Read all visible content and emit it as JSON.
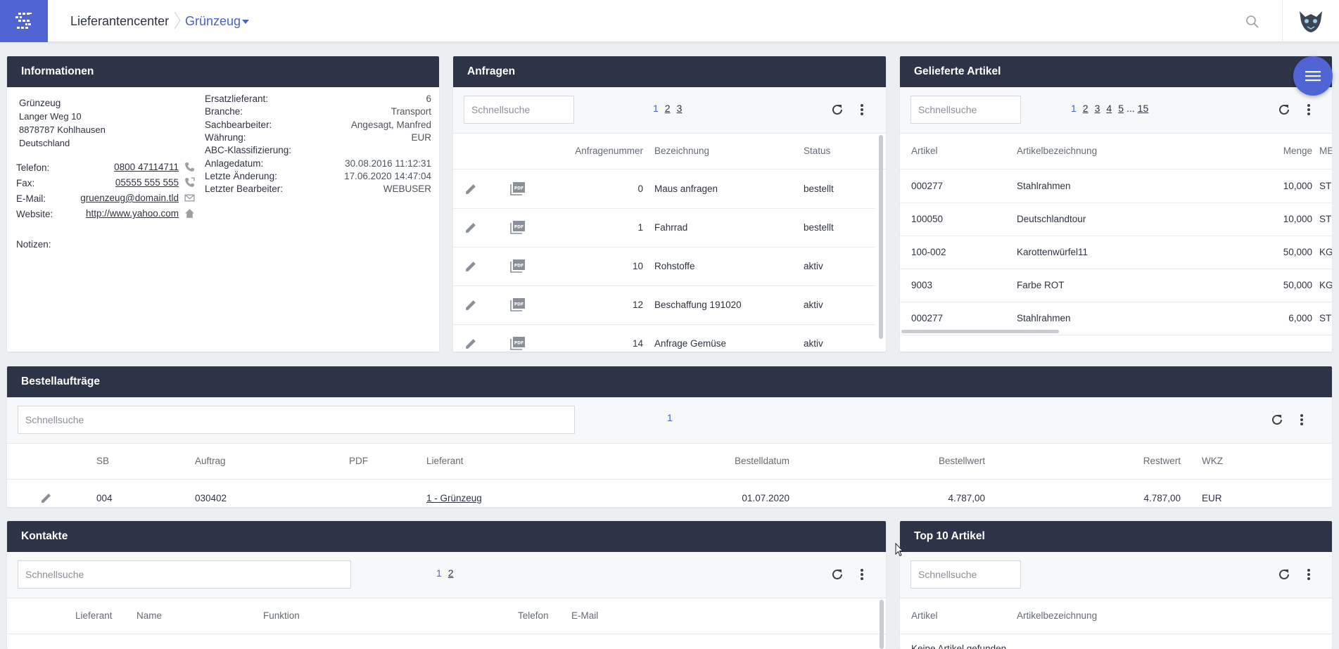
{
  "header": {
    "breadcrumb_root": "Lieferantencenter",
    "breadcrumb_current": "Grünzeug"
  },
  "colors": {
    "accent": "#5164d4",
    "panel_header": "#2e3447",
    "background": "#eceff2"
  },
  "info": {
    "title": "Informationen",
    "address": [
      "Grünzeug",
      "Langer Weg 10",
      "8878787 Kohlhausen",
      "Deutschland"
    ],
    "contacts": [
      {
        "label": "Telefon:",
        "value": "0800 47114711",
        "icon": "phone-icon"
      },
      {
        "label": "Fax:",
        "value": "05555 555 555",
        "icon": "fax-icon"
      },
      {
        "label": "E-Mail:",
        "value": "gruenzeug@domain.tld",
        "icon": "mail-icon"
      },
      {
        "label": "Website:",
        "value": "http://www.yahoo.com",
        "icon": "home-icon"
      }
    ],
    "notes_label": "Notizen:",
    "fields": [
      {
        "label": "Ersatzlieferant:",
        "value": "6"
      },
      {
        "label": "Branche:",
        "value": "Transport"
      },
      {
        "label": "Sachbearbeiter:",
        "value": "Angesagt, Manfred"
      },
      {
        "label": "Währung:",
        "value": "EUR"
      },
      {
        "label": "ABC-Klassifizierung:",
        "value": ""
      },
      {
        "label": "Anlagedatum:",
        "value": "30.08.2016 11:12:31"
      },
      {
        "label": "Letzte Änderung:",
        "value": "17.06.2020 14:47:04"
      },
      {
        "label": "Letzter Bearbeiter:",
        "value": "WEBUSER"
      }
    ]
  },
  "anfragen": {
    "title": "Anfragen",
    "search_placeholder": "Schnellsuche",
    "pages": [
      "1",
      "2",
      "3"
    ],
    "columns": [
      "Anfragenummer",
      "Bezeichnung",
      "Status"
    ],
    "rows": [
      {
        "nr": "0",
        "bez": "Maus anfragen",
        "status": "bestellt"
      },
      {
        "nr": "1",
        "bez": "Fahrrad",
        "status": "bestellt"
      },
      {
        "nr": "10",
        "bez": "Rohstoffe",
        "status": "aktiv"
      },
      {
        "nr": "12",
        "bez": "Beschaffung 191020",
        "status": "aktiv"
      },
      {
        "nr": "14",
        "bez": "Anfrage Gemüse",
        "status": "aktiv"
      }
    ]
  },
  "geliefert": {
    "title": "Gelieferte Artikel",
    "search_placeholder": "Schnellsuche",
    "pages": [
      "1",
      "2",
      "3",
      "4",
      "5"
    ],
    "ellipsis": "...",
    "last_page": "15",
    "columns": [
      "Artikel",
      "Artikelbezeichnung",
      "Menge",
      "ME"
    ],
    "rows": [
      {
        "art": "000277",
        "bez": "Stahlrahmen",
        "menge": "10,000",
        "me": "ST"
      },
      {
        "art": "100050",
        "bez": "Deutschlandtour",
        "menge": "10,000",
        "me": "ST"
      },
      {
        "art": "100-002",
        "bez": "Karottenwürfel11",
        "menge": "50,000",
        "me": "KG"
      },
      {
        "art": "9003",
        "bez": "Farbe ROT",
        "menge": "50,000",
        "me": "KG"
      },
      {
        "art": "000277",
        "bez": "Stahlrahmen",
        "menge": "6,000",
        "me": "ST"
      }
    ]
  },
  "bestell": {
    "title": "Bestellaufträge",
    "search_placeholder": "Schnellsuche",
    "pages": [
      "1"
    ],
    "columns": [
      "SB",
      "Auftrag",
      "PDF",
      "Lieferant",
      "Bestelldatum",
      "Bestellwert",
      "Restwert",
      "WKZ"
    ],
    "rows": [
      {
        "sb": "004",
        "auftrag": "030402",
        "lieferant": "1 - Grünzeug",
        "datum": "01.07.2020",
        "wert": "4.787,00",
        "rest": "4.787,00",
        "wkz": "EUR"
      }
    ]
  },
  "kontakte": {
    "title": "Kontakte",
    "search_placeholder": "Schnellsuche",
    "pages": [
      "1",
      "2"
    ],
    "columns": [
      "Lieferant",
      "Name",
      "Funktion",
      "Telefon",
      "E-Mail"
    ]
  },
  "top10": {
    "title": "Top 10 Artikel",
    "search_placeholder": "Schnellsuche",
    "columns": [
      "Artikel",
      "Artikelbezeichnung"
    ],
    "empty_text": "Keine Artikel gefunden"
  }
}
